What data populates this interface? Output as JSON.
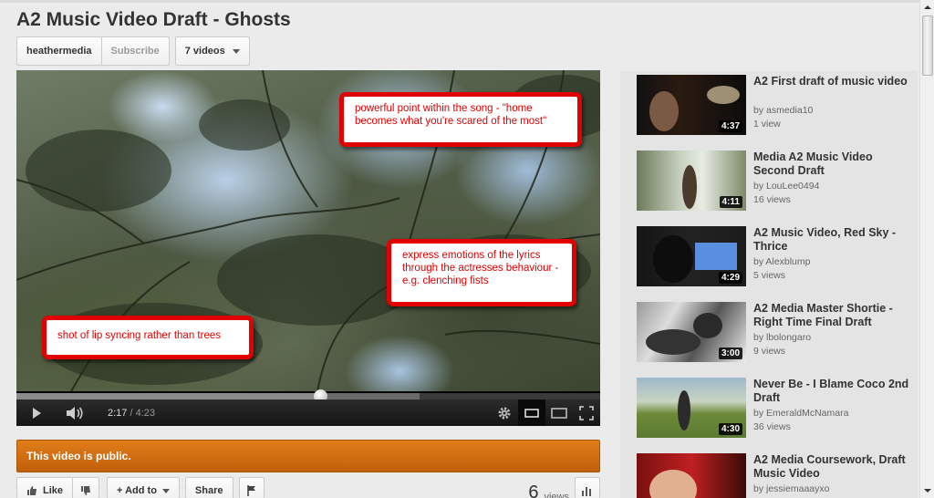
{
  "video": {
    "title": "A2 Music Video Draft - Ghosts",
    "channel": "heathermedia",
    "subscribe_label": "Subscribe",
    "videos_count_label": "7 videos",
    "public_notice": "This video is public.",
    "views_count": "6",
    "views_label": "views"
  },
  "player": {
    "current_time": "2:17",
    "separator": " / ",
    "duration": "4:23",
    "played_fraction": 0.521,
    "loaded_fraction": 0.69
  },
  "annotations": [
    "powerful point within the song - \"home becomes what you're scared of the most\"",
    "express emotions of the lyrics through the actresses behaviour - e.g. clenching fists",
    "shot of lip syncing rather than trees"
  ],
  "actions": {
    "like_label": "Like",
    "add_to_label": "+ Add to",
    "share_label": "Share"
  },
  "related": [
    {
      "title": "A2 First draft of music video",
      "by": "by asmedia10",
      "views": "1 view",
      "duration": "4:37"
    },
    {
      "title": "Media A2 Music Video Second Draft",
      "by": "by LouLee0494",
      "views": "16 views",
      "duration": "4:11"
    },
    {
      "title": "A2 Music Video, Red Sky - Thrice",
      "by": "by Alexblump",
      "views": "5 views",
      "duration": "4:29"
    },
    {
      "title": "A2 Media Master Shortie - Right Time Final Draft",
      "by": "by lbolongaro",
      "views": "9 views",
      "duration": "3:00"
    },
    {
      "title": "Never Be - I Blame Coco 2nd Draft",
      "by": "by EmeraldMcNamara",
      "views": "36 views",
      "duration": "4:30"
    },
    {
      "title": "A2 Media Coursework, Draft Music Video",
      "by": "by jessiemaaayxo",
      "views": "",
      "duration": ""
    }
  ],
  "colors": {
    "annotation_red": "#e00000",
    "public_orange": "#d06d12",
    "page_bg": "#ebebeb"
  }
}
